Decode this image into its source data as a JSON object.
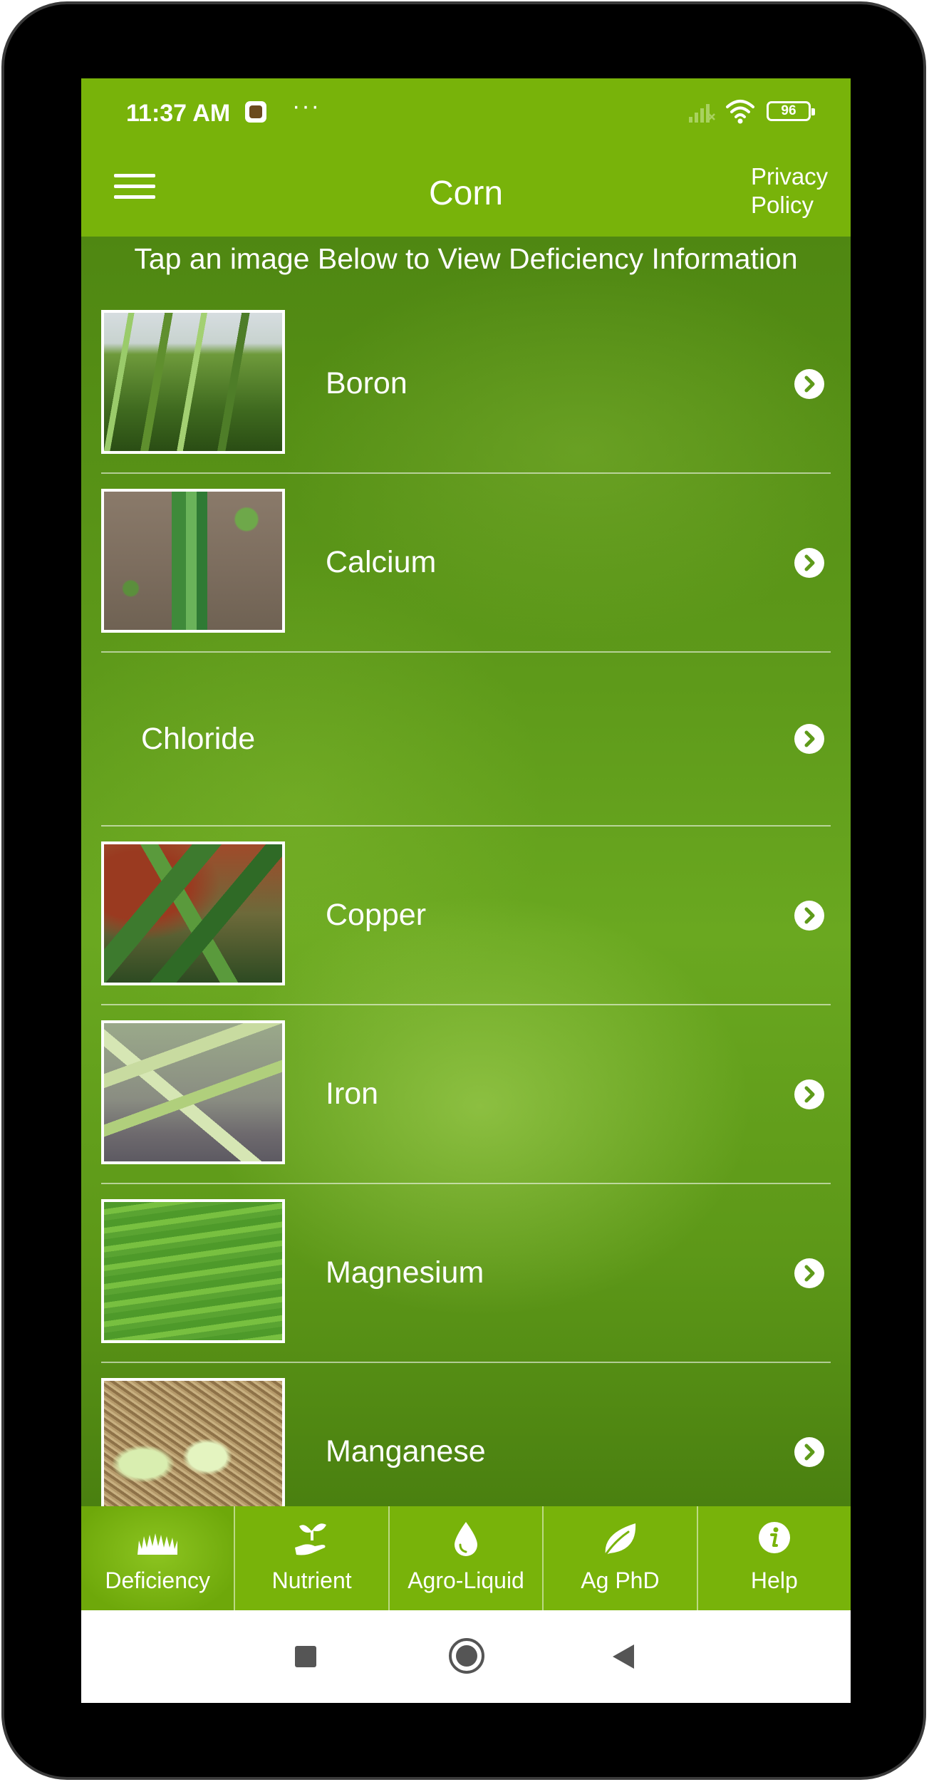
{
  "status_bar": {
    "time": "11:37 AM",
    "overflow": "···",
    "battery": "96",
    "icons": [
      "notification-app-icon",
      "signal-icon",
      "wifi-icon",
      "battery-icon"
    ]
  },
  "toolbar": {
    "title": "Corn",
    "privacy_label": "Privacy Policy",
    "menu_icon": "hamburger-menu-icon"
  },
  "instruction": "Tap an image Below to View Deficiency Information",
  "deficiencies": [
    {
      "label": "Boron",
      "has_image": true,
      "thumb": "boron"
    },
    {
      "label": "Calcium",
      "has_image": true,
      "thumb": "calcium"
    },
    {
      "label": "Chloride",
      "has_image": false
    },
    {
      "label": "Copper",
      "has_image": true,
      "thumb": "copper"
    },
    {
      "label": "Iron",
      "has_image": true,
      "thumb": "iron"
    },
    {
      "label": "Magnesium",
      "has_image": true,
      "thumb": "magnesium"
    },
    {
      "label": "Manganese",
      "has_image": true,
      "thumb": "manganese"
    }
  ],
  "bottom_nav": [
    {
      "label": "Deficiency",
      "icon": "grass-icon",
      "active": true
    },
    {
      "label": "Nutrient",
      "icon": "seedling-hand-icon",
      "active": false
    },
    {
      "label": "Agro-Liquid",
      "icon": "droplet-icon",
      "active": false
    },
    {
      "label": "Ag PhD",
      "icon": "leaf-icon",
      "active": false
    },
    {
      "label": "Help",
      "icon": "info-icon",
      "active": false
    }
  ],
  "colors": {
    "brand_green": "#78b30a",
    "text": "#ffffff"
  }
}
